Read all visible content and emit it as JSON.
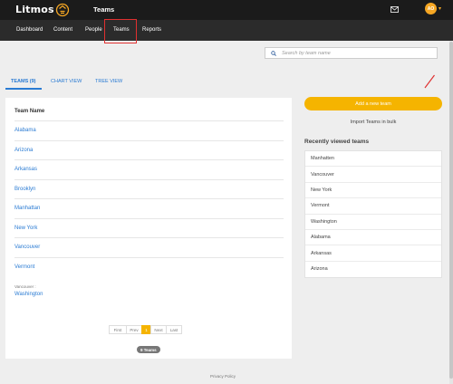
{
  "header": {
    "logo_text": "Litmos",
    "app_title": "Teams",
    "avatar_initials": "AO",
    "brand_color": "#f5a623"
  },
  "nav": {
    "items": [
      "Dashboard",
      "Content",
      "People",
      "Teams",
      "Reports"
    ],
    "active": "Teams"
  },
  "search": {
    "placeholder": "Search by team name"
  },
  "tabs": [
    {
      "label": "TEAMS (9)",
      "active": true
    },
    {
      "label": "CHART VIEW",
      "active": false
    },
    {
      "label": "TREE VIEW",
      "active": false
    }
  ],
  "team_table": {
    "column_header": "Team Name",
    "teams": [
      "Alabama",
      "Arizona",
      "Arkansas",
      "Brooklyn",
      "Manhattan",
      "New York",
      "Vancouver",
      "Vermont"
    ],
    "sub_team": {
      "parent": "Vancouver :",
      "name": "Washington"
    }
  },
  "pagination": {
    "first": "First",
    "prev": "Prev",
    "current": "1",
    "next": "Next",
    "last": "Last"
  },
  "team_count_badge": "9 Teams",
  "sidebar": {
    "add_button": "Add a new team",
    "import_link": "Import Teams in bulk",
    "recent_heading": "Recently viewed teams",
    "recent_teams": [
      "Manhatten",
      "Vancouver",
      "New York",
      "Vermont",
      "Washington",
      "Alabama",
      "Arkansas",
      "Arizona"
    ]
  },
  "footer": {
    "privacy": "Privacy Policy"
  },
  "colors": {
    "accent": "#f5b400",
    "link": "#2a7bd3",
    "topbar": "#1b1b1b",
    "navbar": "#2b2b2b",
    "highlight": "#e03030"
  }
}
